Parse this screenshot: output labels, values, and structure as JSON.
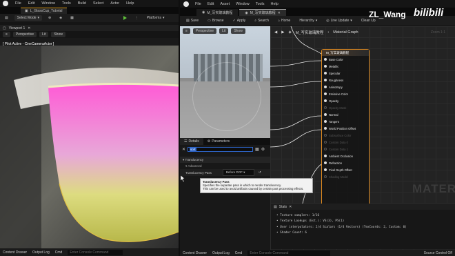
{
  "left_editor": {
    "menu": [
      "File",
      "Edit",
      "Window",
      "Tools",
      "Build",
      "Select",
      "Actor",
      "Help"
    ],
    "level_tab": "L_GlassCup_Tutorial",
    "toolbar": {
      "select_mode": "Select Mode",
      "platforms": "Platforms"
    },
    "viewport_tab": "Viewport 1",
    "viewport_tools": [
      "Perspective",
      "Lit",
      "Show"
    ],
    "pilot_label": "[ Pilot Active - CineCameraActor ]",
    "status": {
      "content_drawer": "Content Drawer",
      "output_log": "Output Log",
      "cmd": "Cmd",
      "console_placeholder": "Enter Console Command"
    }
  },
  "material_editor": {
    "menu": [
      "File",
      "Edit",
      "Asset",
      "Window",
      "Tools",
      "Help"
    ],
    "tabs": [
      "M_写实玻璃教程",
      "M_写实玻璃教程"
    ],
    "toolbar": [
      "Save",
      "Browse",
      "Apply",
      "Search",
      "Home",
      "Hierarchy",
      "Live Update",
      "Clean Up"
    ],
    "preview_tools": [
      "Perspective",
      "Lit",
      "Show"
    ],
    "details_tabs": [
      "Details",
      "Parameters"
    ],
    "search_value": "sort",
    "section": "Translucency",
    "subsection": "Advanced",
    "property": {
      "label": "Translucency Pass",
      "value": "Before DOF"
    },
    "breadcrumb": "M_写实玻璃教程",
    "graph_title": "Material Graph",
    "zoom": "Zoom 1:1",
    "node_title": "M_写实玻璃教程",
    "pins": [
      {
        "label": "Base Color",
        "enabled": true
      },
      {
        "label": "Metallic",
        "enabled": true
      },
      {
        "label": "Specular",
        "enabled": true
      },
      {
        "label": "Roughness",
        "enabled": true
      },
      {
        "label": "Anisotropy",
        "enabled": true
      },
      {
        "label": "Emissive Color",
        "enabled": true
      },
      {
        "label": "Opacity",
        "enabled": true
      },
      {
        "label": "Opacity Mask",
        "enabled": false
      },
      {
        "label": "Normal",
        "enabled": true
      },
      {
        "label": "Tangent",
        "enabled": true
      },
      {
        "label": "World Position Offset",
        "enabled": true
      },
      {
        "label": "Subsurface Color",
        "enabled": false
      },
      {
        "label": "Custom Data 0",
        "enabled": false
      },
      {
        "label": "Custom Data 1",
        "enabled": false
      },
      {
        "label": "Ambient Occlusion",
        "enabled": true
      },
      {
        "label": "Refraction",
        "enabled": true
      },
      {
        "label": "Pixel Depth Offset",
        "enabled": true
      },
      {
        "label": "Shading Model",
        "enabled": false
      }
    ],
    "graph_watermark": "MATERIAL",
    "tooltip": {
      "title": "Translucency Pass",
      "line1": "Specifies the separate pass in which to render translucency.",
      "line2": "This can be used to avoid artifacts caused by certain post processing effects."
    },
    "stats": {
      "title": "Stats",
      "lines": [
        "• Texture samplers: 1/16",
        "• Texture Lookups (Est.): VS(3), PS(1)",
        "• User interpolators: 2/4 Scalars (1/4 Vectors) (TexCoords: 2, Custom: 0)",
        "• Shader Count: 6"
      ]
    },
    "status": {
      "content_drawer": "Content Drawer",
      "output_log": "Output Log",
      "cmd": "Cmd",
      "console_placeholder": "Enter Console Command",
      "source_control": "Source Control Off"
    }
  },
  "watermark": {
    "author": "ZL_Wang",
    "brand": "bilibili"
  },
  "colors": {
    "accent_orange": "#e08a20",
    "selection_blue": "#2d64c8",
    "cup_pink": "#ff33cc",
    "cup_yellow": "#c9cc55"
  }
}
